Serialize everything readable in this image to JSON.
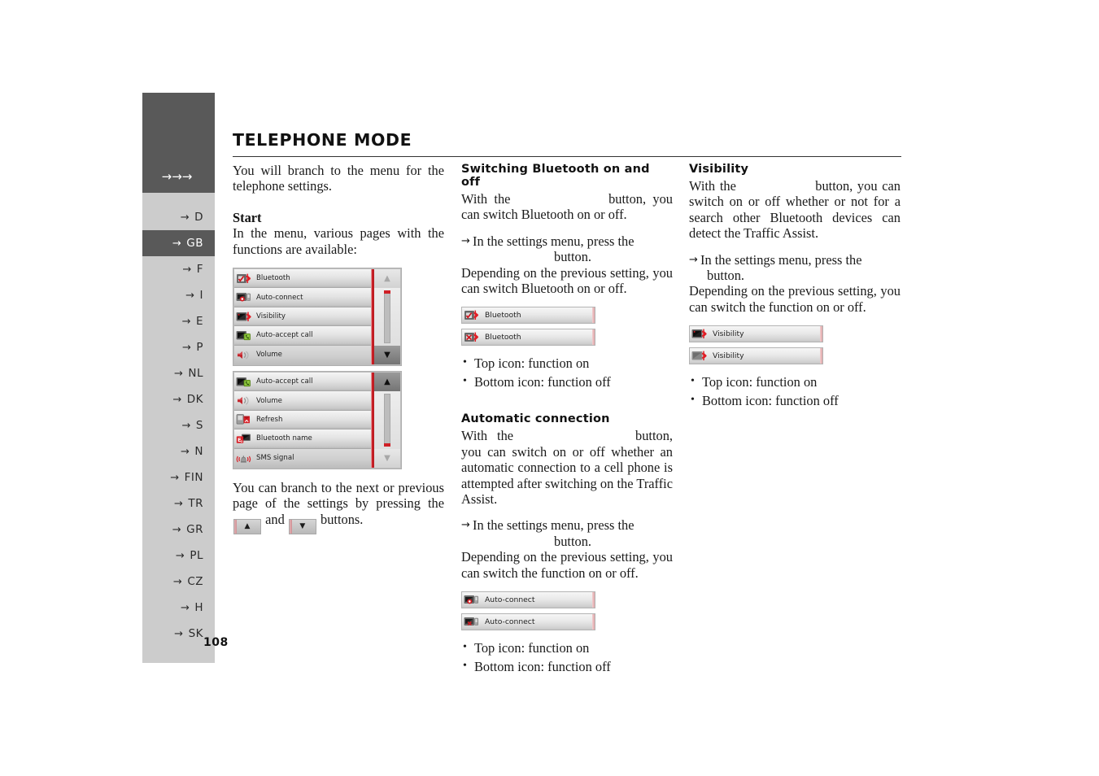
{
  "header": {
    "arrows": "→→→",
    "title": "TELEPHONE MODE",
    "page_number": "108"
  },
  "sidebar": {
    "items": [
      {
        "arrow": "→",
        "label": "D",
        "active": false
      },
      {
        "arrow": "→",
        "label": "GB",
        "active": true
      },
      {
        "arrow": "→",
        "label": "F",
        "active": false
      },
      {
        "arrow": "→",
        "label": "I",
        "active": false
      },
      {
        "arrow": "→",
        "label": "E",
        "active": false
      },
      {
        "arrow": "→",
        "label": "P",
        "active": false
      },
      {
        "arrow": "→",
        "label": "NL",
        "active": false
      },
      {
        "arrow": "→",
        "label": "DK",
        "active": false
      },
      {
        "arrow": "→",
        "label": "S",
        "active": false
      },
      {
        "arrow": "→",
        "label": "N",
        "active": false
      },
      {
        "arrow": "→",
        "label": "FIN",
        "active": false
      },
      {
        "arrow": "→",
        "label": "TR",
        "active": false
      },
      {
        "arrow": "→",
        "label": "GR",
        "active": false
      },
      {
        "arrow": "→",
        "label": "PL",
        "active": false
      },
      {
        "arrow": "→",
        "label": "CZ",
        "active": false
      },
      {
        "arrow": "→",
        "label": "H",
        "active": false
      },
      {
        "arrow": "→",
        "label": "SK",
        "active": false
      }
    ]
  },
  "column1": {
    "intro": "You will branch to the menu for the telephone settings.",
    "start_heading": "Start",
    "start_text": "In the menu, various pages with the functions are available:",
    "menu_page1": {
      "rows": [
        {
          "label": "Bluetooth",
          "icon": "bluetooth-check-icon"
        },
        {
          "label": "Auto-connect",
          "icon": "auto-connect-icon"
        },
        {
          "label": "Visibility",
          "icon": "visibility-icon"
        },
        {
          "label": "Auto-accept call",
          "icon": "auto-accept-call-icon"
        },
        {
          "label": "Volume",
          "icon": "volume-icon"
        }
      ],
      "scroll_up_enabled": false,
      "scroll_down_enabled": true,
      "marker_position": "top",
      "up_arrow": "▲",
      "down_arrow": "▼"
    },
    "menu_page2": {
      "rows": [
        {
          "label": "Auto-accept call",
          "icon": "auto-accept-call-icon"
        },
        {
          "label": "Volume",
          "icon": "volume-icon"
        },
        {
          "label": "Refresh",
          "icon": "refresh-icon"
        },
        {
          "label": "Bluetooth name",
          "icon": "bluetooth-name-icon"
        },
        {
          "label": "SMS signal",
          "icon": "sms-signal-icon"
        }
      ],
      "scroll_up_enabled": true,
      "scroll_down_enabled": false,
      "marker_position": "bottom",
      "up_arrow": "▲",
      "down_arrow": "▼"
    },
    "branch_text_a": "You can branch to the next or previous page of the settings by pressing the",
    "branch_text_b": "and",
    "branch_text_c": "buttons.",
    "nav_up_glyph": "▲",
    "nav_down_glyph": "▼"
  },
  "column2": {
    "bluetooth": {
      "heading": "Switching Bluetooth on and off",
      "intro_a": "With the",
      "intro_b": "button, you can switch Bluetooth on or off.",
      "step_arrow": "→",
      "step_line1": "In the settings menu, press the",
      "step_line2": "button.",
      "after_step": "Depending on the previous setting, you can switch Bluetooth on or off.",
      "buttons": [
        {
          "label": "Bluetooth",
          "icon": "bluetooth-on-icon",
          "state": "on"
        },
        {
          "label": "Bluetooth",
          "icon": "bluetooth-off-icon",
          "state": "off"
        }
      ],
      "bullets": [
        "Top icon: function on",
        "Bottom icon: function off"
      ]
    },
    "auto_connection": {
      "heading": "Automatic connection",
      "intro_a": "With the",
      "intro_b": "button, you can switch on or off whether an automatic connection to a cell phone is attempted after switching on the Traffic Assist.",
      "step_arrow": "→",
      "step_line1": "In the settings menu, press the",
      "step_line2": "button.",
      "after_step": "Depending on the previous setting, you can switch the function on or off.",
      "buttons": [
        {
          "label": "Auto-connect",
          "icon": "auto-connect-on-icon",
          "state": "on"
        },
        {
          "label": "Auto-connect",
          "icon": "auto-connect-off-icon",
          "state": "off"
        }
      ],
      "bullets": [
        "Top icon: function on",
        "Bottom icon: function off"
      ]
    }
  },
  "column3": {
    "visibility": {
      "heading": "Visibility",
      "intro_a": "With the",
      "intro_b": "button, you can switch on or off whether or not for a search other Bluetooth devices can detect the Traffic Assist.",
      "step_arrow": "→",
      "step_line1": "In the settings menu, press the",
      "step_line2": "button.",
      "after_step": "Depending on the previous setting, you can switch the function on or off.",
      "buttons": [
        {
          "label": "Visibility",
          "icon": "visibility-on-icon",
          "state": "on"
        },
        {
          "label": "Visibility",
          "icon": "visibility-off-icon",
          "state": "off"
        }
      ],
      "bullets": [
        "Top icon: function on",
        "Bottom icon: function off"
      ]
    }
  },
  "colors": {
    "sidebar_active": "#595959",
    "sidebar_bg": "#cccccc",
    "accent_red": "#cf1f26",
    "text": "#1a1a1a"
  }
}
